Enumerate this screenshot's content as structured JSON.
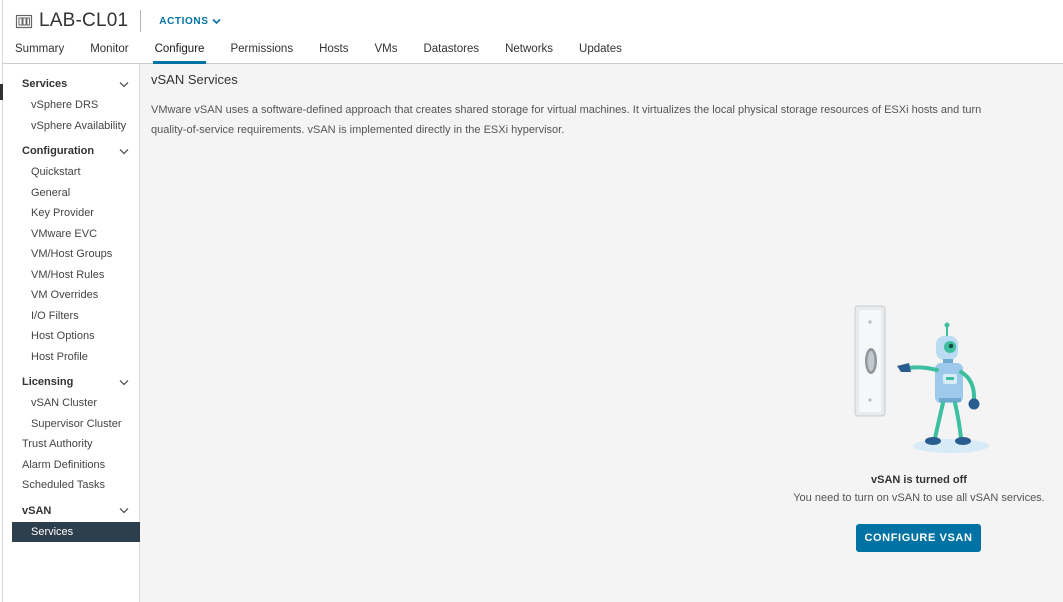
{
  "header": {
    "object_title": "LAB-CL01",
    "actions_label": "ACTIONS",
    "tabs": [
      {
        "label": "Summary"
      },
      {
        "label": "Monitor"
      },
      {
        "label": "Configure"
      },
      {
        "label": "Permissions"
      },
      {
        "label": "Hosts"
      },
      {
        "label": "VMs"
      },
      {
        "label": "Datastores"
      },
      {
        "label": "Networks"
      },
      {
        "label": "Updates"
      }
    ],
    "active_tab": "Configure"
  },
  "sidebar": {
    "groups": [
      {
        "label": "Services",
        "items": [
          "vSphere DRS",
          "vSphere Availability"
        ]
      },
      {
        "label": "Configuration",
        "items": [
          "Quickstart",
          "General",
          "Key Provider",
          "VMware EVC",
          "VM/Host Groups",
          "VM/Host Rules",
          "VM Overrides",
          "I/O Filters",
          "Host Options",
          "Host Profile"
        ]
      },
      {
        "label": "Licensing",
        "items": [
          "vSAN Cluster",
          "Supervisor Cluster"
        ]
      }
    ],
    "top_items": [
      "Trust Authority",
      "Alarm Definitions",
      "Scheduled Tasks"
    ],
    "vsan_group": {
      "label": "vSAN",
      "items": [
        "Services"
      ]
    },
    "selected_item": "Services"
  },
  "content": {
    "title": "vSAN Services",
    "description_line1": "VMware vSAN uses a software-defined approach that creates shared storage for virtual machines. It virtualizes the local physical storage resources of ESXi hosts and turn",
    "description_line2": "quality-of-service requirements. vSAN is implemented directly in the ESXi hypervisor.",
    "status_title": "vSAN is turned off",
    "status_text": "You need to turn on vSAN to use all vSAN services.",
    "configure_button": "CONFIGURE VSAN"
  },
  "colors": {
    "accent": "#0072a3",
    "selected_bg": "#2d3e4d",
    "robot_teal": "#3dbfa0",
    "robot_blue": "#9dc9ea"
  },
  "icons": {
    "title_icon": "cluster-icon",
    "actions_icon": "chevron-down-icon",
    "group_toggle_icon": "chevron-down-icon",
    "illustration": "robot-light-switch-illustration"
  }
}
